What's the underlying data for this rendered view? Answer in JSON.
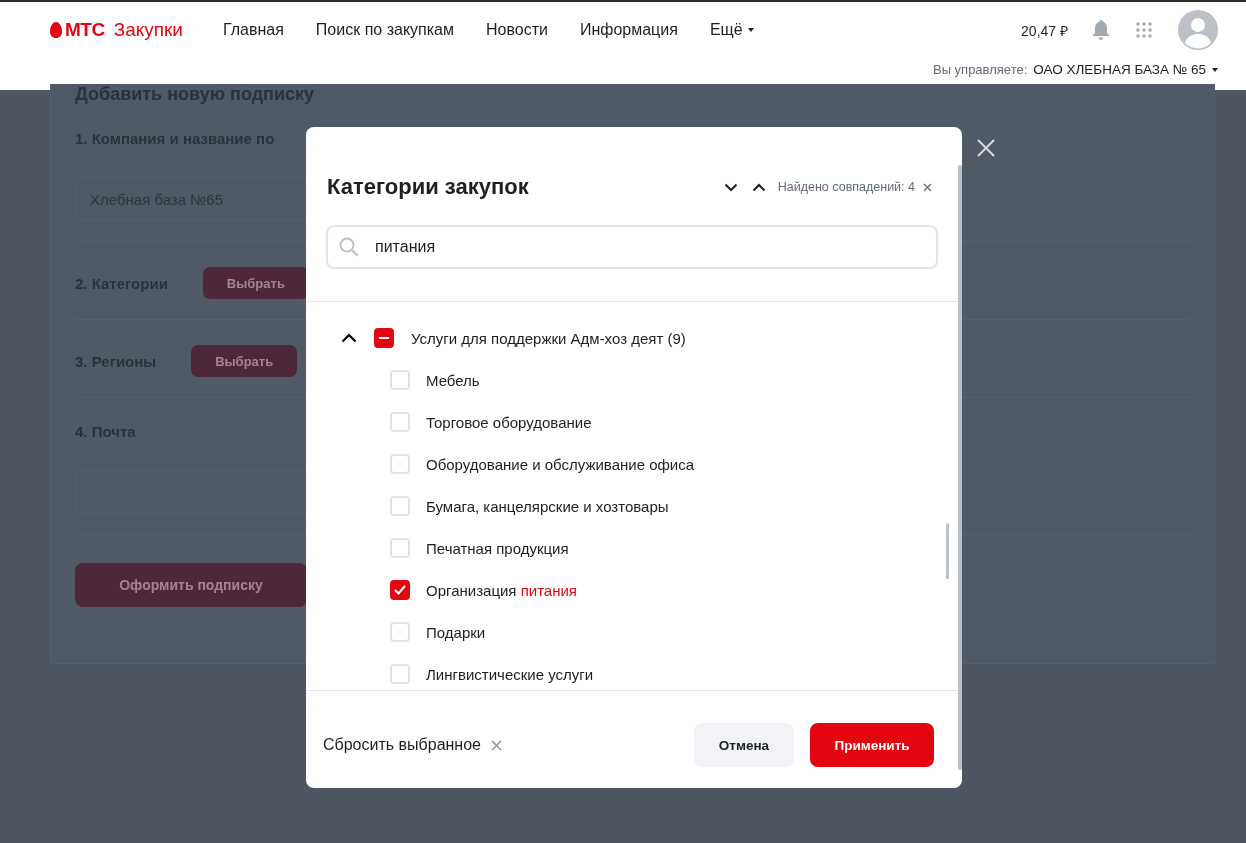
{
  "header": {
    "logo": "МТС",
    "product": "Закупки",
    "nav": [
      {
        "label": "Главная",
        "dropdown": false
      },
      {
        "label": "Поиск по закупкам",
        "dropdown": false
      },
      {
        "label": "Новости",
        "dropdown": false
      },
      {
        "label": "Информация",
        "dropdown": false
      },
      {
        "label": "Ещё",
        "dropdown": true
      }
    ],
    "balance": "20,47 ₽",
    "manage_label": "Вы управляете:",
    "company": "ОАО ХЛЕБНАЯ БАЗА № 65"
  },
  "page": {
    "title": "Добавить новую подписку",
    "sections": [
      {
        "kind": "field",
        "heading": "1. Компания и название по",
        "value": "Хлебная база №65"
      },
      {
        "kind": "button",
        "heading": "2. Категории",
        "button": "Выбрать"
      },
      {
        "kind": "button",
        "heading": "3. Регионы",
        "button": "Выбрать"
      },
      {
        "kind": "field",
        "heading": "4. Почта"
      }
    ],
    "submit": "Оформить подписку"
  },
  "modal": {
    "title": "Категории закупок",
    "matches": "Найдено совпадений: 4",
    "search": {
      "value": "питания"
    },
    "group": {
      "label": "Услуги для поддержки Адм-хоз деят (9)",
      "expanded": true,
      "indeterminate": true,
      "children": [
        {
          "label": "Мебель",
          "checked": false
        },
        {
          "label": "Торговое оборудование",
          "checked": false
        },
        {
          "label": "Оборудование и обслуживание офиса",
          "checked": false
        },
        {
          "label": "Бумага, канцелярские и хозтовары",
          "checked": false
        },
        {
          "label": "Печатная продукция",
          "checked": false
        },
        {
          "label": "Организация",
          "match": "питания",
          "checked": true
        },
        {
          "label": "Подарки",
          "checked": false
        },
        {
          "label": "Лингвистические услуги",
          "checked": false
        }
      ]
    },
    "reset": "Сбросить выбранное",
    "cancel": "Отмена",
    "apply": "Применить"
  }
}
